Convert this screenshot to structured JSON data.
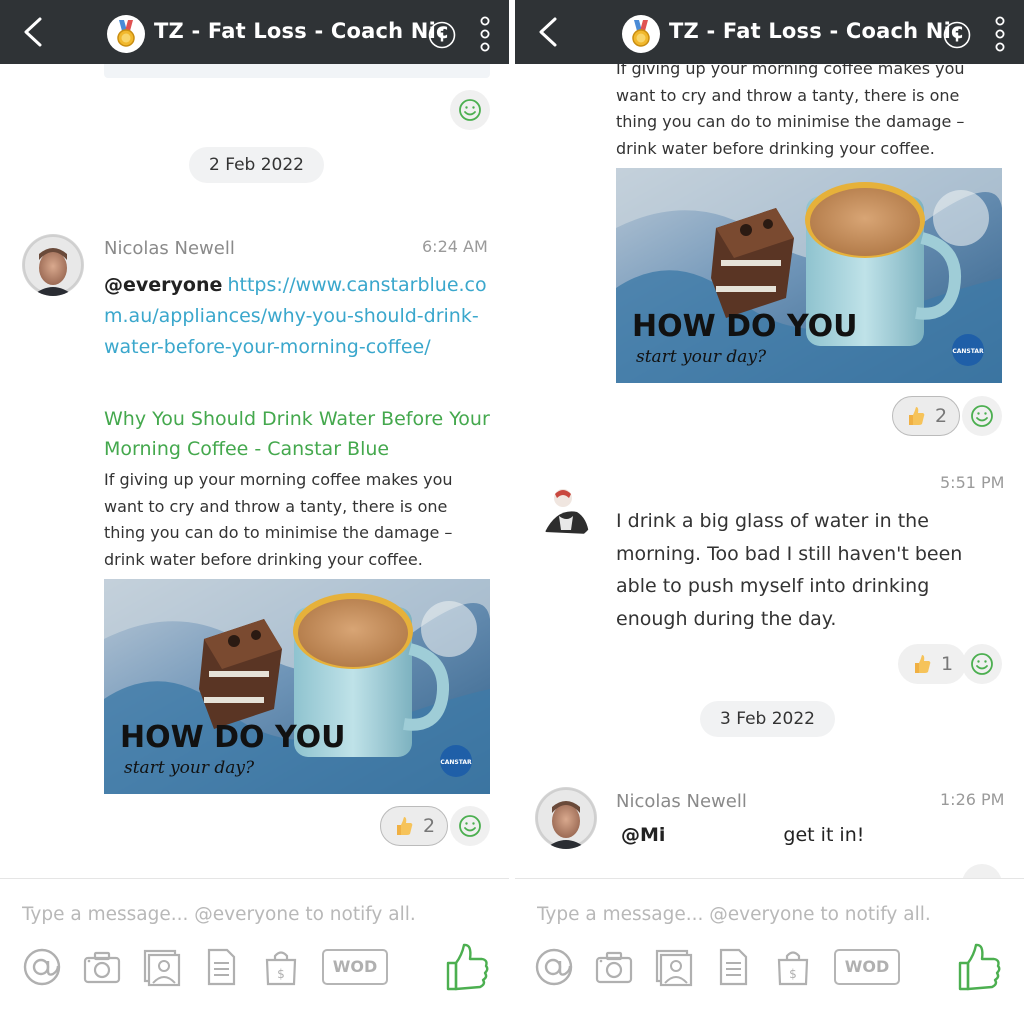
{
  "chat": {
    "title": "TZ - Fat Loss - Coach Nic",
    "composer_placeholder": "Type a message... @everyone to notify all.",
    "wod_label": "WOD"
  },
  "colors": {
    "header_bg": "#2f3336",
    "link": "#3aa7cc",
    "preview_title": "#44a84d",
    "accent_green": "#4caf50"
  },
  "left": {
    "date": "2 Feb 2022",
    "message": {
      "sender": "Nicolas Newell",
      "time": "6:24 AM",
      "mention": "@everyone",
      "link": "https://www.canstarblue.com.au/appliances/why-you-should-drink-water-before-your-morning-coffee/",
      "preview_title": "Why You Should Drink Water Before Your Morning Coffee - Canstar Blue",
      "preview_desc": "If giving up your morning coffee makes you want to cry and throw a tanty, there is one thing you can do to minimise the damage – drink water before drinking your coffee.",
      "image_caption_main": "HOW DO YOU",
      "image_caption_script": "start your day?",
      "image_logo": "CANSTAR",
      "like_count": "2"
    }
  },
  "right": {
    "top_desc": "If giving up your morning coffee makes you want to cry and throw a tanty, there is one thing you can do to minimise the damage – drink water before drinking your coffee.",
    "image_caption_main": "HOW DO YOU",
    "image_caption_script": "start your day?",
    "image_logo": "CANSTAR",
    "like_count_1": "2",
    "reply": {
      "time": "5:51 PM",
      "text": "I drink a big glass of water in the morning. Too bad I still haven't been able to push myself into drinking enough during the day.",
      "like_count": "1"
    },
    "date": "3 Feb 2022",
    "message2": {
      "sender": "Nicolas Newell",
      "time": "1:26 PM",
      "text_start": "@Mi",
      "text_end": "get it in!"
    }
  }
}
